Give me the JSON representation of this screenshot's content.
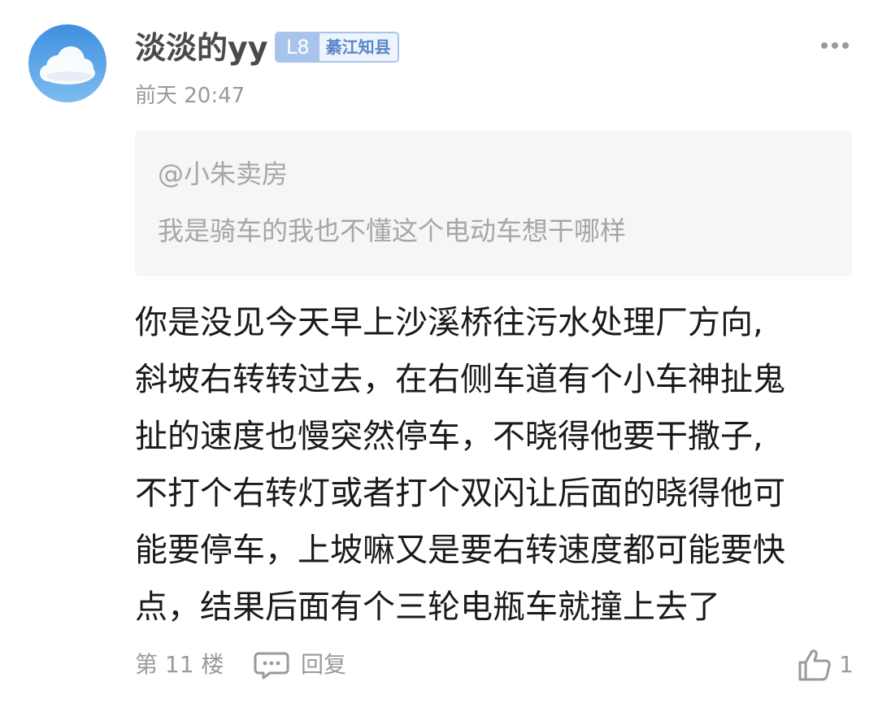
{
  "comment": {
    "username": "淡淡的yy",
    "level": "L8",
    "region": "綦江知县",
    "timestamp": "前天 20:47",
    "avatar_icon": "cloud-avatar",
    "quote": {
      "user": "@小朱卖房",
      "text": "我是骑车的我也不懂这个电动车想干哪样"
    },
    "content_lines": [
      "你是没见今天早上沙溪桥往污水处理厂方向,",
      "斜坡右转转过去，在右侧车道有个小车神扯鬼",
      "扯的速度也慢突然停车，不晓得他要干撒子,",
      "不打个右转灯或者打个双闪让后面的晓得他可",
      "能要停车，上坡嘛又是要右转速度都可能要快",
      "点，结果后面有个三轮电瓶车就撞上去了"
    ],
    "footer": {
      "floor": "第 11 楼",
      "reply_label": "回复",
      "like_count": "1"
    }
  },
  "colors": {
    "level_badge": "#a9c4ec",
    "region_text": "#5a86c8",
    "muted_text": "#9a9a9a",
    "quote_bg": "#f6f6f6"
  }
}
